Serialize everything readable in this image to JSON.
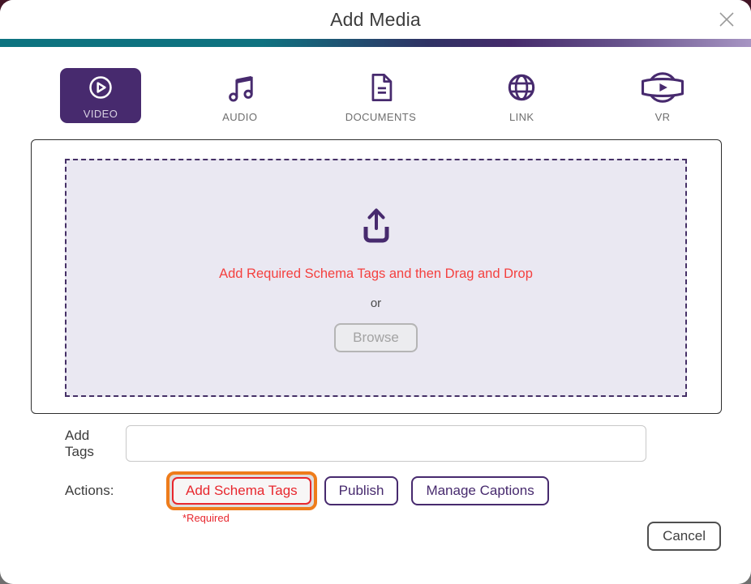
{
  "dialog": {
    "title": "Add Media"
  },
  "tabs": [
    {
      "label": "VIDEO",
      "icon": "play-circle-icon",
      "active": true
    },
    {
      "label": "AUDIO",
      "icon": "music-note-icon",
      "active": false
    },
    {
      "label": "DOCUMENTS",
      "icon": "document-icon",
      "active": false
    },
    {
      "label": "LINK",
      "icon": "globe-icon",
      "active": false
    },
    {
      "label": "VR",
      "icon": "vr-360-icon",
      "active": false
    }
  ],
  "dropzone": {
    "instruction": "Add Required Schema Tags and then Drag and Drop",
    "or_text": "or",
    "browse_label": "Browse"
  },
  "tags": {
    "label": "Add Tags",
    "value": ""
  },
  "actions": {
    "label": "Actions:",
    "add_schema_tags_label": "Add Schema Tags",
    "publish_label": "Publish",
    "manage_captions_label": "Manage Captions",
    "required_note": "*Required"
  },
  "footer": {
    "cancel_label": "Cancel"
  },
  "colors": {
    "brand_purple": "#472a6e",
    "danger_red": "#e8272e",
    "instruction_red": "#f4403f",
    "highlight_orange": "#ee7c1b",
    "gradient_teal": "#0d7380",
    "gradient_lavender": "#a795c3",
    "dropzone_bg": "#eae8f2"
  }
}
